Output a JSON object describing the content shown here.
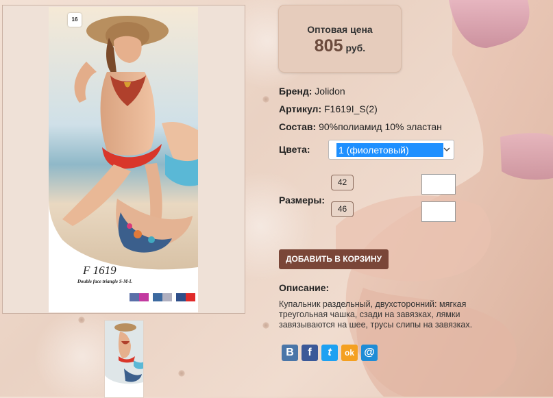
{
  "gallery": {
    "main_image_alt": "Model in two-tone bikini on beach",
    "catalog_number": "16",
    "model_code": "F 1619",
    "model_caption": "Double face triangle S-M-L",
    "thumbnail_alt": "Thumbnail"
  },
  "price": {
    "label": "Оптовая цена",
    "value": "805",
    "currency": "руб."
  },
  "details": {
    "brand_label": "Бренд:",
    "brand_value": "Jolidon",
    "sku_label": "Артикул:",
    "sku_value": "F1619I_S(2)",
    "composition_label": "Состав:",
    "composition_value": "90%полиамид 10% эластан"
  },
  "colors": {
    "label": "Цвета:",
    "selected": "1 (фиолетовый)"
  },
  "sizes": {
    "label": "Размеры:",
    "items": [
      "42",
      "46"
    ]
  },
  "cart": {
    "add_label": "ДОБАВИТЬ В КОРЗИНУ"
  },
  "description": {
    "title": "Описание:",
    "text": "Купальник раздельный, двухсторонний: мягкая треугольная чашка, сзади на завязках, лямки завязываются на шее, трусы слипы на завязках."
  },
  "share": {
    "vk": "В",
    "facebook": "f",
    "twitter": "t",
    "odnoklassniki": "ok",
    "mail": "@"
  },
  "theme": {
    "accent": "#7a4638",
    "price_box": "#e6ccbc",
    "select_highlight": "#1e90ff",
    "vk": "#4a76a8",
    "facebook": "#3b5998",
    "twitter": "#1da1f2",
    "odnoklassniki": "#f4a020",
    "mail": "#1e8cd6"
  }
}
